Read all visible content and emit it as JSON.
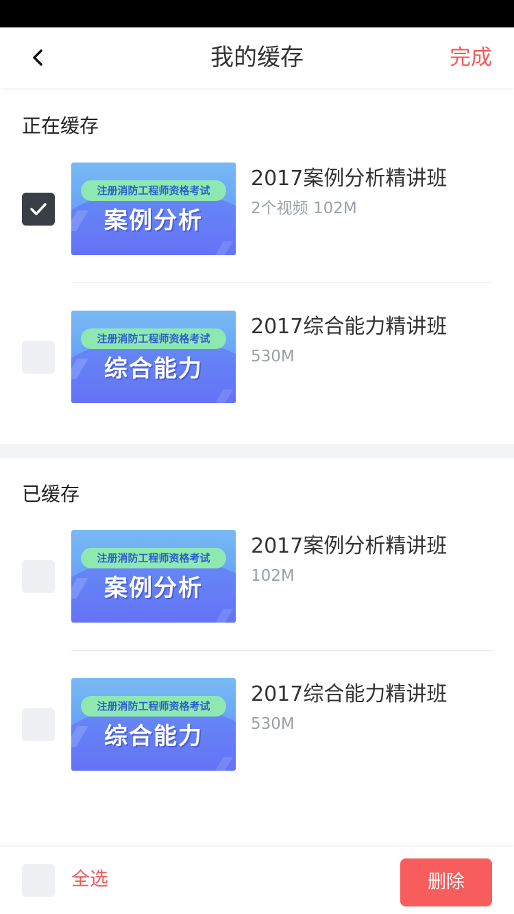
{
  "header": {
    "title": "我的缓存",
    "done_label": "完成"
  },
  "downloading": {
    "title": "正在缓存",
    "items": [
      {
        "title": "2017案例分析精讲班",
        "meta": "2个视频  102M",
        "checked": true,
        "thumb_tag": "注册消防工程师资格考试",
        "thumb_big": "案例分析"
      },
      {
        "title": "2017综合能力精讲班",
        "meta": "530M",
        "checked": false,
        "thumb_tag": "注册消防工程师资格考试",
        "thumb_big": "综合能力"
      }
    ]
  },
  "downloaded": {
    "title": "已缓存",
    "items": [
      {
        "title": "2017案例分析精讲班",
        "meta": "102M",
        "checked": false,
        "thumb_tag": "注册消防工程师资格考试",
        "thumb_big": "案例分析"
      },
      {
        "title": "2017综合能力精讲班",
        "meta": "530M",
        "checked": false,
        "thumb_tag": "注册消防工程师资格考试",
        "thumb_big": "综合能力"
      }
    ]
  },
  "footer": {
    "select_all_label": "全选",
    "delete_label": "删除"
  },
  "colors": {
    "accent": "#f05b5b",
    "delete_button": "#f75d5d",
    "checkbox_checked": "#3a3f47",
    "checkbox_unchecked": "#eef0f3"
  }
}
